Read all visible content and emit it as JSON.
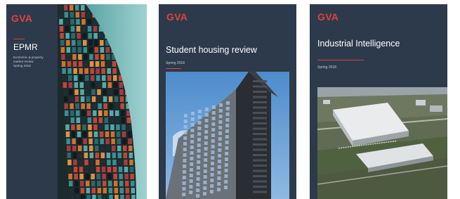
{
  "cards": [
    {
      "logo": "GVA",
      "title": "EPMR",
      "subtitle": "Economic & property market review",
      "date": "Spring 2018",
      "image": "curved-glass-building-photo"
    },
    {
      "logo": "GVA",
      "title": "Student housing review",
      "date": "Spring 2018",
      "image": "residential-tower-photo"
    },
    {
      "logo": "GVA",
      "title": "Industrial Intelligence",
      "date": "Spring 2018",
      "image": "warehouse-aerial-photo"
    }
  ],
  "colors": {
    "cover_bg": "#2d3a4b",
    "brand_red": "#e0413d",
    "text_white": "#ffffff",
    "text_muted": "#c7cdd6"
  }
}
